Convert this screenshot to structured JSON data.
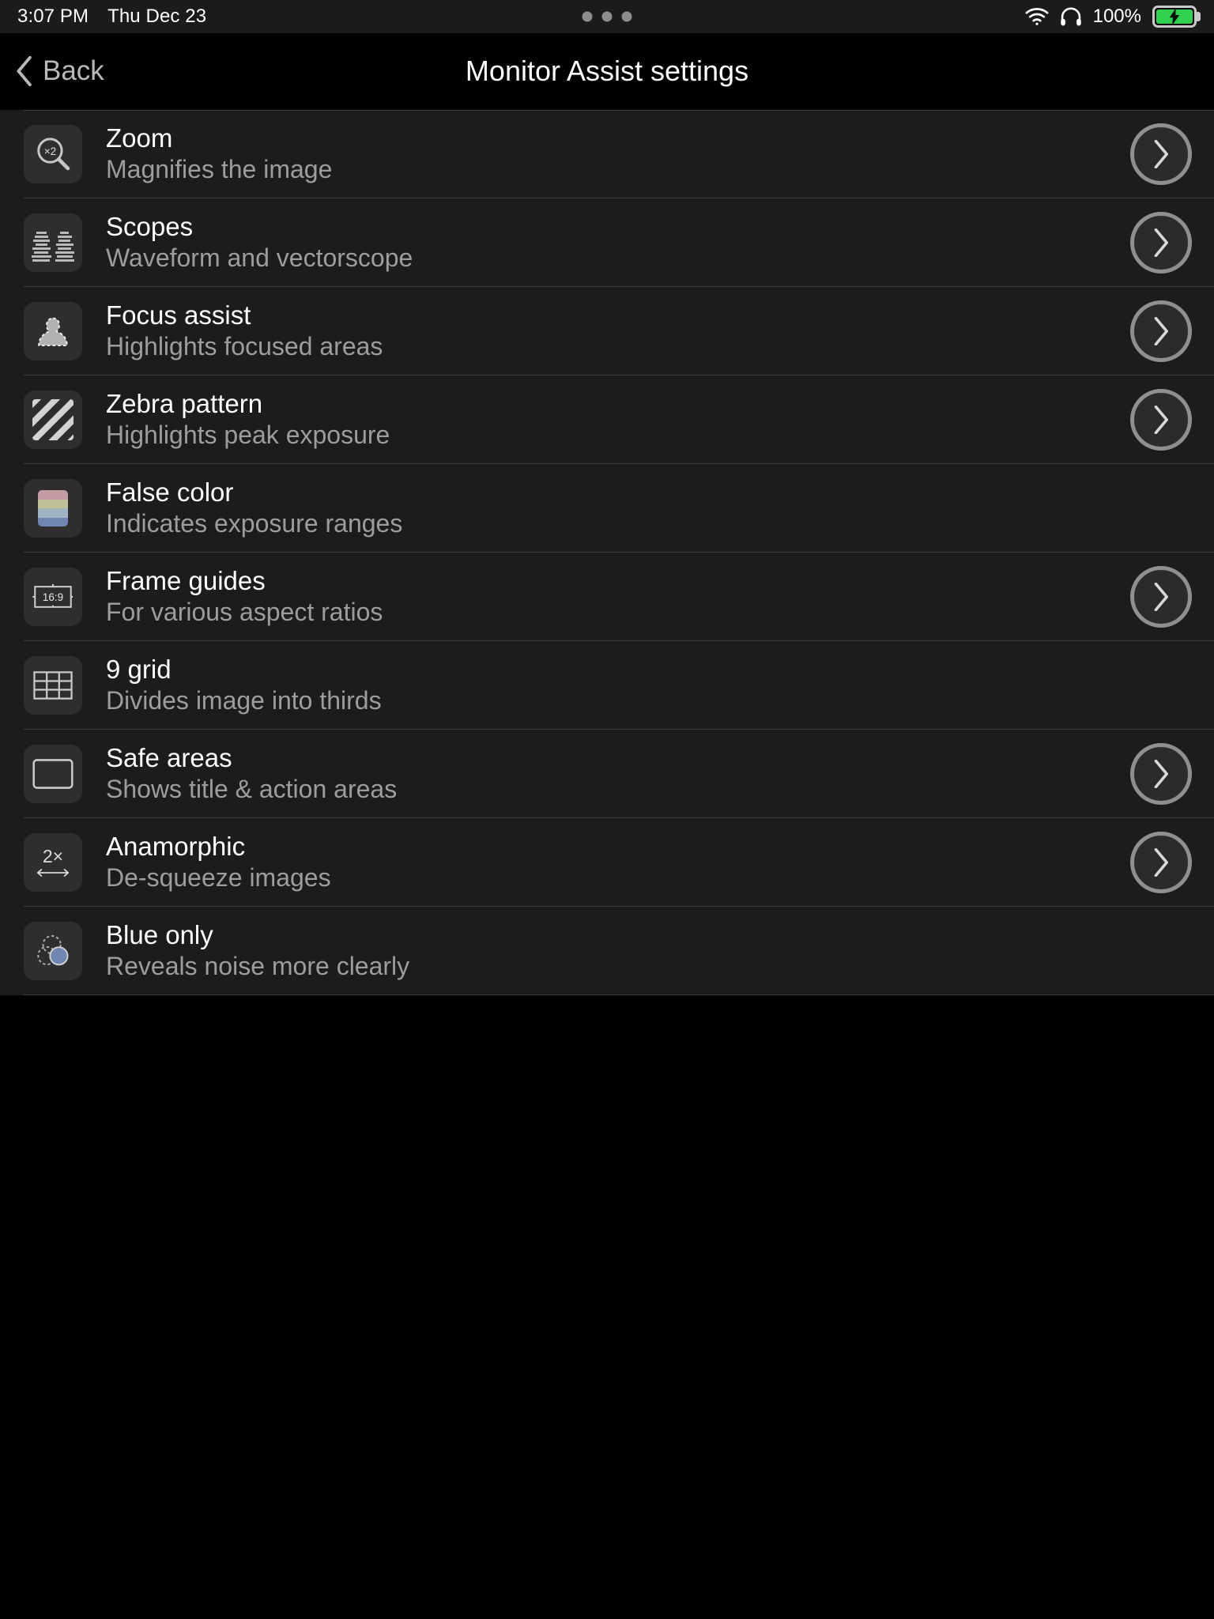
{
  "statusbar": {
    "time": "3:07 PM",
    "date": "Thu Dec 23",
    "battery_percent": "100%",
    "wifi_icon": "wifi-icon",
    "headphones_icon": "headphones-icon",
    "battery_icon": "battery-charging-icon",
    "page_dots_icon": "three-dots-indicator",
    "battery_color": "#2fd14f"
  },
  "navbar": {
    "back_label": "Back",
    "back_icon": "chevron-left-icon",
    "title": "Monitor Assist settings"
  },
  "list": {
    "items": [
      {
        "icon": "zoom-magnifier-icon",
        "icon_label": "×2",
        "title": "Zoom",
        "subtitle": "Magnifies the image",
        "has_chevron": true
      },
      {
        "icon": "waveform-scope-icon",
        "icon_label": "",
        "title": "Scopes",
        "subtitle": "Waveform and vectorscope",
        "has_chevron": true
      },
      {
        "icon": "focus-assist-person-icon",
        "icon_label": "",
        "title": "Focus assist",
        "subtitle": "Highlights focused areas",
        "has_chevron": true
      },
      {
        "icon": "zebra-stripes-icon",
        "icon_label": "",
        "title": "Zebra pattern",
        "subtitle": "Highlights peak exposure",
        "has_chevron": true
      },
      {
        "icon": "false-color-bands-icon",
        "icon_label": "",
        "title": "False color",
        "subtitle": "Indicates exposure ranges",
        "has_chevron": false
      },
      {
        "icon": "frame-guides-icon",
        "icon_label": "16:9",
        "title": "Frame guides",
        "subtitle": "For various aspect ratios",
        "has_chevron": true
      },
      {
        "icon": "nine-grid-icon",
        "icon_label": "",
        "title": "9 grid",
        "subtitle": "Divides image into thirds",
        "has_chevron": false
      },
      {
        "icon": "safe-areas-rect-icon",
        "icon_label": "",
        "title": "Safe areas",
        "subtitle": "Shows title & action areas",
        "has_chevron": true
      },
      {
        "icon": "anamorphic-desqueeze-icon",
        "icon_label": "2×",
        "title": "Anamorphic",
        "subtitle": "De-squeeze images",
        "has_chevron": true
      },
      {
        "icon": "blue-only-circles-icon",
        "icon_label": "",
        "title": "Blue only",
        "subtitle": "Reveals noise more clearly",
        "has_chevron": false
      }
    ],
    "chevron_icon": "chevron-right-icon",
    "false_color_bands": [
      "#c49ca4",
      "#c0c098",
      "#9fb4c0",
      "#7286b4"
    ],
    "blue_only_color": "#7286b4"
  }
}
